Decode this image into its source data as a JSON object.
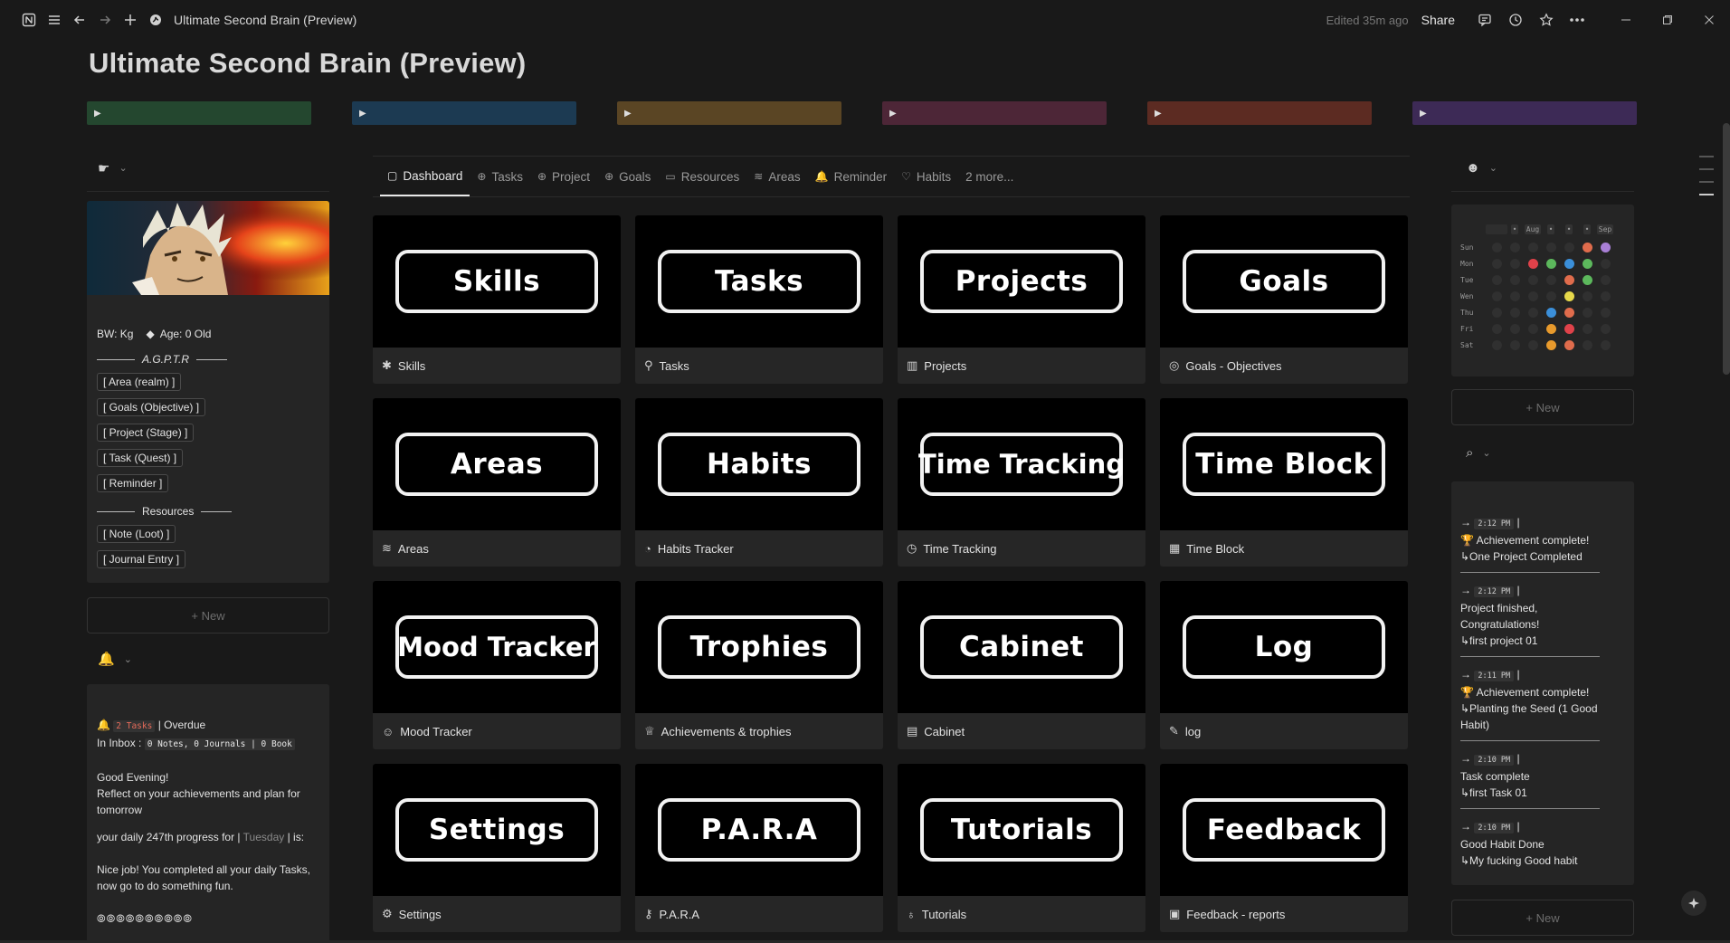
{
  "window": {
    "page_title": "Ultimate Second Brain (Preview)",
    "edited": "Edited 35m ago",
    "share": "Share"
  },
  "colors": {
    "bar_green": "#24472f",
    "bar_blue": "#1c3a52",
    "bar_brown": "#5a4524",
    "bar_maroon": "#4d2637",
    "bar_rust": "#5c2b22",
    "bar_purple": "#3d2a56"
  },
  "left": {
    "profile": {
      "bw": "BW:  Kg",
      "age": "Age: 0 Old",
      "section1": "A.G.P.T.R",
      "chips1": [
        "[ Area (realm) ]",
        "[ Goals (Objective) ]",
        "[ Project (Stage) ]",
        "[ Task (Quest) ]",
        "[ Reminder ]"
      ],
      "section2": "Resources",
      "chips2": [
        "[ Note (Loot) ]",
        "[ Journal Entry ]"
      ]
    },
    "new_label": "+ New",
    "notes": {
      "tasks_badge": "2 Tasks",
      "overdue": "| Overdue",
      "inbox_label": "In Inbox :",
      "inbox_badge": "0 Notes, 0 Journals | 0 Book",
      "greeting": "Good Evening!",
      "reflect": "Reflect on your achievements and plan for tomorrow",
      "progress_a": "your daily 247th progress for |",
      "progress_day": "Tuesday",
      "progress_b": "| is:",
      "completed": "Nice job! You completed all your daily Tasks, now go to do something fun.",
      "dots": "⦾⦾⦾⦾⦾⦾⦾⦾⦾⦾"
    }
  },
  "tabs": [
    {
      "icon": "▢",
      "label": "Dashboard"
    },
    {
      "icon": "⊕",
      "label": "Tasks"
    },
    {
      "icon": "⊕",
      "label": "Project"
    },
    {
      "icon": "⊕",
      "label": "Goals"
    },
    {
      "icon": "▭",
      "label": "Resources"
    },
    {
      "icon": "≋",
      "label": "Areas"
    },
    {
      "icon": "🔔",
      "label": "Reminder"
    },
    {
      "icon": "♡",
      "label": "Habits"
    },
    {
      "icon": "",
      "label": "2 more..."
    }
  ],
  "cards": [
    {
      "label": "Skills",
      "icon": "✱",
      "title": "Skills"
    },
    {
      "label": "Tasks",
      "icon": "⚲",
      "title": "Tasks"
    },
    {
      "label": "Projects",
      "icon": "▥",
      "title": "Projects"
    },
    {
      "label": "Goals",
      "icon": "◎",
      "title": "Goals - Objectives"
    },
    {
      "label": "Areas",
      "icon": "≋",
      "title": "Areas"
    },
    {
      "label": "Habits",
      "icon": "◔",
      "title": "Habits Tracker"
    },
    {
      "label": "Time Tracking",
      "icon": "◷",
      "title": "Time Tracking"
    },
    {
      "label": "Time Block",
      "icon": "▦",
      "title": "Time Block"
    },
    {
      "label": "Mood Tracker",
      "icon": "☺",
      "title": "Mood Tracker"
    },
    {
      "label": "Trophies",
      "icon": "♕",
      "title": "Achievements & trophies"
    },
    {
      "label": "Cabinet",
      "icon": "▤",
      "title": "Cabinet"
    },
    {
      "label": "Log",
      "icon": "✎",
      "title": "log"
    },
    {
      "label": "Settings",
      "icon": "⚙",
      "title": "Settings"
    },
    {
      "label": "P.A.R.A",
      "icon": "⚷",
      "title": "P.A.R.A"
    },
    {
      "label": "Tutorials",
      "icon": "♁",
      "title": "Tutorials"
    },
    {
      "label": "Feedback",
      "icon": "▣",
      "title": "Feedback - reports"
    }
  ],
  "heatmap": {
    "headers": [
      "",
      "•",
      "Aug",
      "•",
      "•",
      "•",
      "Sep"
    ],
    "rows": [
      {
        "day": "Sun",
        "cells": [
          "",
          "",
          "",
          "",
          "",
          "#e06c4c",
          "#a97fd6"
        ]
      },
      {
        "day": "Mon",
        "cells": [
          "",
          "",
          "#e0424a",
          "#5cb85c",
          "#3b8fd9",
          "#5cb85c",
          ""
        ]
      },
      {
        "day": "Tue",
        "cells": [
          "",
          "",
          "",
          "",
          "#e06c4c",
          "#5cb85c",
          ""
        ]
      },
      {
        "day": "Wen",
        "cells": [
          "",
          "",
          "",
          "",
          "#e6d84a",
          "",
          ""
        ]
      },
      {
        "day": "Thu",
        "cells": [
          "",
          "",
          "",
          "#3b8fd9",
          "#e06c4c",
          "",
          ""
        ]
      },
      {
        "day": "Fri",
        "cells": [
          "",
          "",
          "",
          "#e89a2c",
          "#e0424a",
          "",
          ""
        ]
      },
      {
        "day": "Sat",
        "cells": [
          "",
          "",
          "",
          "#e89a2c",
          "#e06c4c",
          "",
          ""
        ]
      }
    ]
  },
  "right": {
    "new_label": "+ New",
    "log": [
      {
        "time": "2:12 PM",
        "l1": "🏆 Achievement complete!",
        "l2": "↳One Project Completed",
        "l3": ""
      },
      {
        "time": "2:12 PM",
        "l1": "Project finished, Congratulations!",
        "l2": "↳first project 01",
        "l3": ""
      },
      {
        "time": "2:11 PM",
        "l1": "🏆 Achievement complete!",
        "l2": "↳Planting the Seed (1 Good Habit)",
        "l3": ""
      },
      {
        "time": "2:10 PM",
        "l1": "Task complete",
        "l2": "↳first Task 01",
        "l3": ""
      },
      {
        "time": "2:10 PM",
        "l1": "Good Habit Done",
        "l2": "↳My fucking Good  habit",
        "l3": ""
      }
    ],
    "new_label2": "+ New"
  }
}
